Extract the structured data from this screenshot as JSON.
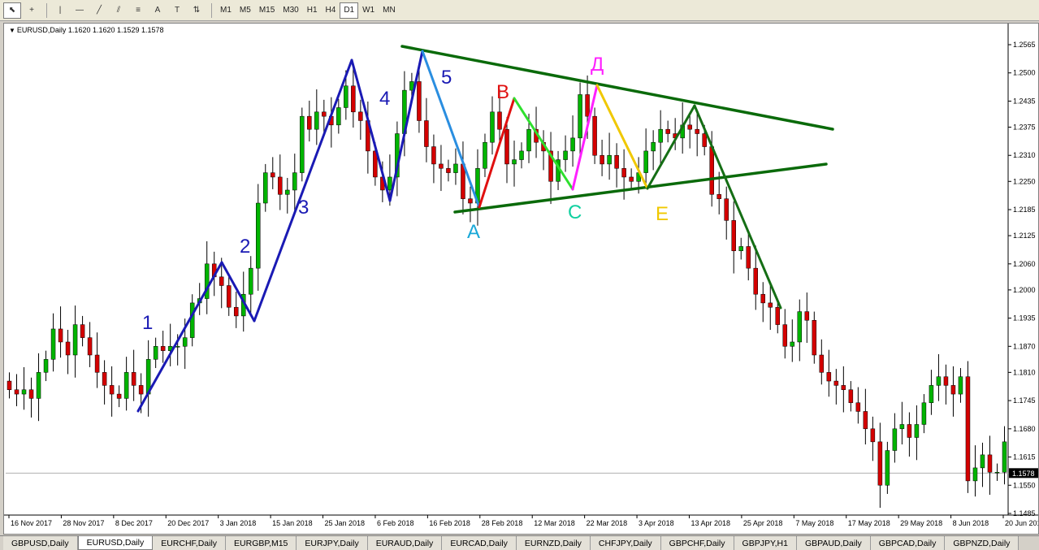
{
  "toolbar": {
    "tools": [
      {
        "name": "cursor-icon",
        "glyph": "⬉"
      },
      {
        "name": "crosshair-icon",
        "glyph": "+"
      },
      {
        "name": "vertical-line-icon",
        "glyph": "|"
      },
      {
        "name": "horizontal-line-icon",
        "glyph": "—"
      },
      {
        "name": "trendline-icon",
        "glyph": "╱"
      },
      {
        "name": "equidistant-channel-icon",
        "glyph": "⫽"
      },
      {
        "name": "fibonacci-icon",
        "glyph": "≡"
      },
      {
        "name": "text-icon",
        "glyph": "A"
      },
      {
        "name": "text-label-icon",
        "glyph": "T"
      },
      {
        "name": "arrows-icon",
        "glyph": "⇅"
      }
    ],
    "timeframes": [
      "M1",
      "M5",
      "M15",
      "M30",
      "H1",
      "H4",
      "D1",
      "W1",
      "MN"
    ],
    "active_timeframe": "D1"
  },
  "chart": {
    "title": "EURUSD,Daily  1.1620 1.1620 1.1529 1.1578",
    "current_price_label": "1.1578",
    "current_price": 1.1578,
    "colors": {
      "bull": "#00b400",
      "bear": "#d40000",
      "wick": "#000000",
      "wave_blue": "#1a1ab4",
      "wave_light_blue": "#2a8ee0",
      "triangle": "#0a6a0a",
      "red": "#e01010",
      "green": "#2ee02e",
      "magenta": "#ff20ff",
      "yellow": "#f0c800",
      "dark_green": "#156e15"
    },
    "wave_labels": [
      {
        "text": "1",
        "color": "#1a1ab4"
      },
      {
        "text": "2",
        "color": "#1a1ab4"
      },
      {
        "text": "3",
        "color": "#1a1ab4"
      },
      {
        "text": "4",
        "color": "#1a1ab4"
      },
      {
        "text": "5",
        "color": "#1a1ab4"
      },
      {
        "text": "A",
        "color": "#19a8d8"
      },
      {
        "text": "B",
        "color": "#e01010"
      },
      {
        "text": "C",
        "color": "#10d0a0"
      },
      {
        "text": "Д",
        "color": "#ff20ff"
      },
      {
        "text": "E",
        "color": "#f0c800"
      }
    ]
  },
  "chart_data": {
    "type": "candlestick",
    "symbol": "EURUSD",
    "timeframe": "Daily",
    "ylim": [
      1.1485,
      1.2565
    ],
    "y_ticks": [
      "1.2565",
      "1.2500",
      "1.2435",
      "1.2375",
      "1.2310",
      "1.2250",
      "1.2185",
      "1.2125",
      "1.2060",
      "1.2000",
      "1.1935",
      "1.1870",
      "1.1810",
      "1.1745",
      "1.1680",
      "1.1615",
      "1.1550",
      "1.1485"
    ],
    "x_ticks": [
      "16 Nov 2017",
      "28 Nov 2017",
      "8 Dec 2017",
      "20 Dec 2017",
      "3 Jan 2018",
      "15 Jan 2018",
      "25 Jan 2018",
      "6 Feb 2018",
      "16 Feb 2018",
      "28 Feb 2018",
      "12 Mar 2018",
      "22 Mar 2018",
      "3 Apr 2018",
      "13 Apr 2018",
      "25 Apr 2018",
      "7 May 2018",
      "17 May 2018",
      "29 May 2018",
      "8 Jun 2018",
      "20 Jun 2018"
    ],
    "closes": [
      1.177,
      1.176,
      1.177,
      1.175,
      1.181,
      1.184,
      1.191,
      1.188,
      1.185,
      1.192,
      1.189,
      1.185,
      1.181,
      1.178,
      1.176,
      1.175,
      1.181,
      1.178,
      1.176,
      1.184,
      1.187,
      1.186,
      1.187,
      1.187,
      1.189,
      1.197,
      1.198,
      1.206,
      1.203,
      1.201,
      1.196,
      1.194,
      1.199,
      1.205,
      1.22,
      1.227,
      1.226,
      1.222,
      1.223,
      1.227,
      1.24,
      1.237,
      1.241,
      1.24,
      1.238,
      1.242,
      1.247,
      1.241,
      1.239,
      1.232,
      1.226,
      1.223,
      1.226,
      1.236,
      1.246,
      1.248,
      1.239,
      1.233,
      1.229,
      1.228,
      1.227,
      1.229,
      1.221,
      1.22,
      1.228,
      1.234,
      1.241,
      1.237,
      1.229,
      1.23,
      1.232,
      1.237,
      1.234,
      1.232,
      1.225,
      1.23,
      1.232,
      1.235,
      1.245,
      1.24,
      1.231,
      1.229,
      1.231,
      1.228,
      1.226,
      1.225,
      1.227,
      1.232,
      1.234,
      1.237,
      1.236,
      1.235,
      1.238,
      1.237,
      1.236,
      1.233,
      1.222,
      1.221,
      1.216,
      1.209,
      1.21,
      1.205,
      1.199,
      1.197,
      1.196,
      1.192,
      1.187,
      1.188,
      1.195,
      1.193,
      1.185,
      1.181,
      1.179,
      1.178,
      1.177,
      1.174,
      1.172,
      1.168,
      1.165,
      1.155,
      1.163,
      1.168,
      1.169,
      1.166,
      1.169,
      1.174,
      1.178,
      1.18,
      1.178,
      1.176,
      1.18,
      1.156,
      1.159,
      1.162,
      1.158,
      1.158,
      1.165
    ],
    "series": [
      {
        "name": "1",
        "color": "#1a1ab4"
      },
      {
        "name": "2",
        "color": "#1a1ab4"
      },
      {
        "name": "3",
        "color": "#1a1ab4"
      },
      {
        "name": "4",
        "color": "#1a1ab4"
      },
      {
        "name": "5",
        "color": "#2a8ee0"
      },
      {
        "name": "A",
        "color": "#19a8d8"
      },
      {
        "name": "B",
        "color": "#e01010"
      },
      {
        "name": "C",
        "color": "#10d0a0"
      },
      {
        "name": "Д",
        "color": "#ff20ff"
      },
      {
        "name": "E",
        "color": "#f0c800"
      }
    ],
    "grid": false
  },
  "tabs": [
    {
      "label": "GBPUSD,Daily",
      "active": false
    },
    {
      "label": "EURUSD,Daily",
      "active": true
    },
    {
      "label": "EURCHF,Daily",
      "active": false
    },
    {
      "label": "EURGBP,M15",
      "active": false
    },
    {
      "label": "EURJPY,Daily",
      "active": false
    },
    {
      "label": "EURAUD,Daily",
      "active": false
    },
    {
      "label": "EURCAD,Daily",
      "active": false
    },
    {
      "label": "EURNZD,Daily",
      "active": false
    },
    {
      "label": "CHFJPY,Daily",
      "active": false
    },
    {
      "label": "GBPCHF,Daily",
      "active": false
    },
    {
      "label": "GBPJPY,H1",
      "active": false
    },
    {
      "label": "GBPAUD,Daily",
      "active": false
    },
    {
      "label": "GBPCAD,Daily",
      "active": false
    },
    {
      "label": "GBPNZD,Daily",
      "active": false
    }
  ]
}
